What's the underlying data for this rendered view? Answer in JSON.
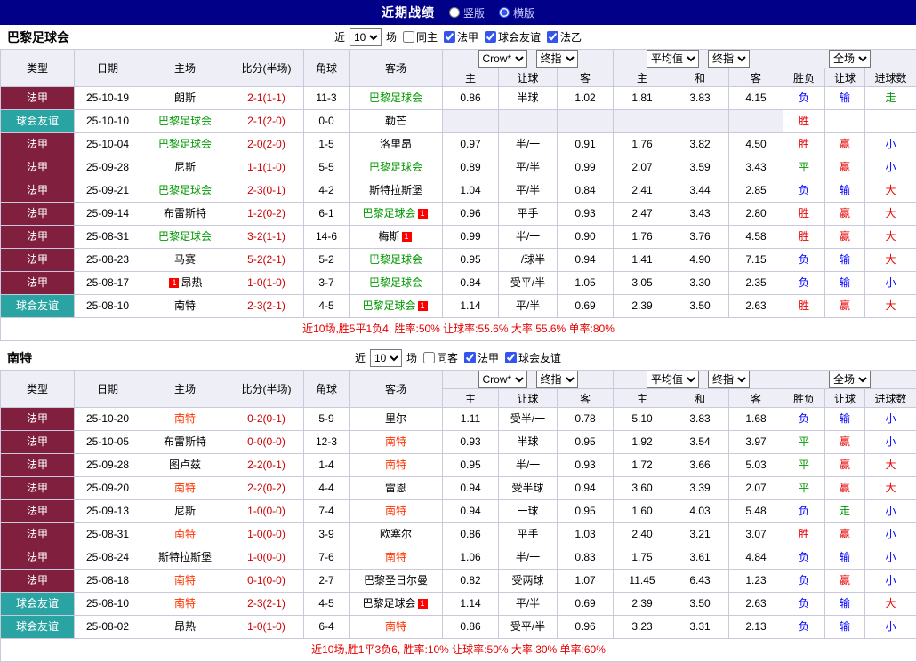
{
  "topbar": {
    "title": "近期战绩",
    "radios": [
      {
        "label": "竖版",
        "selected": false
      },
      {
        "label": "横版",
        "selected": true
      }
    ]
  },
  "filter": {
    "near": "近",
    "count": "10",
    "matches": "场"
  },
  "selects": {
    "crown": "Crow*",
    "final_index": "终指",
    "average": "平均值",
    "full_match": "全场"
  },
  "header": {
    "main": [
      "类型",
      "日期",
      "主场",
      "比分(半场)",
      "角球",
      "客场"
    ],
    "odds": [
      "主",
      "让球",
      "客"
    ],
    "avg": [
      "主",
      "和",
      "客"
    ],
    "result": [
      "胜负",
      "让球",
      "进球数"
    ]
  },
  "colors": {
    "topbar_bg": "#000088",
    "topbar_title": "#ffffff",
    "topbar_link": "#ccccff",
    "header_bg": "#eeeef6",
    "border_color": "#c9c9db",
    "league_bg": "#801f3e",
    "friendly_bg": "#2aa3a3",
    "team_green": "#009900",
    "team_red": "#ff3300",
    "score_color": "#cc0000",
    "win_color": "#e60000",
    "draw_color": "#009900",
    "loss_color": "#0000ff",
    "summary_color": "#e60000",
    "badge_bg": "#ff0000"
  },
  "sections": [
    {
      "team": "巴黎足球会",
      "filters": [
        {
          "label": "同主",
          "checked": false
        },
        {
          "label": "法甲",
          "checked": true
        },
        {
          "label": "球会友谊",
          "checked": true
        },
        {
          "label": "法乙",
          "checked": true
        }
      ],
      "rows": [
        {
          "type": "法甲",
          "type_style": "league",
          "date": "25-10-19",
          "home": "朗斯",
          "home_style": "black",
          "home_badge": "",
          "score": "2-1(1-1)",
          "corner": "11-3",
          "away": "巴黎足球会",
          "away_style": "green",
          "away_badge": "",
          "odds": [
            "0.86",
            "半球",
            "1.02",
            "1.81",
            "3.83",
            "4.15"
          ],
          "results": [
            {
              "t": "负",
              "c": "b"
            },
            {
              "t": "输",
              "c": "b"
            },
            {
              "t": "走",
              "c": "g"
            }
          ]
        },
        {
          "type": "球会友谊",
          "type_style": "friendly",
          "date": "25-10-10",
          "home": "巴黎足球会",
          "home_style": "green",
          "home_badge": "",
          "score": "2-1(2-0)",
          "corner": "0-0",
          "away": "勒芒",
          "away_style": "black",
          "away_badge": "",
          "odds": [
            "",
            "",
            "",
            "",
            "",
            ""
          ],
          "results": [
            {
              "t": "胜",
              "c": "r"
            },
            {
              "t": "",
              "c": ""
            },
            {
              "t": "",
              "c": ""
            }
          ]
        },
        {
          "type": "法甲",
          "type_style": "league",
          "date": "25-10-04",
          "home": "巴黎足球会",
          "home_style": "green",
          "home_badge": "",
          "score": "2-0(2-0)",
          "corner": "1-5",
          "away": "洛里昂",
          "away_style": "black",
          "away_badge": "",
          "odds": [
            "0.97",
            "半/一",
            "0.91",
            "1.76",
            "3.82",
            "4.50"
          ],
          "results": [
            {
              "t": "胜",
              "c": "r"
            },
            {
              "t": "赢",
              "c": "r"
            },
            {
              "t": "小",
              "c": "b"
            }
          ]
        },
        {
          "type": "法甲",
          "type_style": "league",
          "date": "25-09-28",
          "home": "尼斯",
          "home_style": "black",
          "home_badge": "",
          "score": "1-1(1-0)",
          "corner": "5-5",
          "away": "巴黎足球会",
          "away_style": "green",
          "away_badge": "",
          "odds": [
            "0.89",
            "平/半",
            "0.99",
            "2.07",
            "3.59",
            "3.43"
          ],
          "results": [
            {
              "t": "平",
              "c": "g"
            },
            {
              "t": "赢",
              "c": "r"
            },
            {
              "t": "小",
              "c": "b"
            }
          ]
        },
        {
          "type": "法甲",
          "type_style": "league",
          "date": "25-09-21",
          "home": "巴黎足球会",
          "home_style": "green",
          "home_badge": "",
          "score": "2-3(0-1)",
          "corner": "4-2",
          "away": "斯特拉斯堡",
          "away_style": "black",
          "away_badge": "",
          "odds": [
            "1.04",
            "平/半",
            "0.84",
            "2.41",
            "3.44",
            "2.85"
          ],
          "results": [
            {
              "t": "负",
              "c": "b"
            },
            {
              "t": "输",
              "c": "b"
            },
            {
              "t": "大",
              "c": "r"
            }
          ]
        },
        {
          "type": "法甲",
          "type_style": "league",
          "date": "25-09-14",
          "home": "布雷斯特",
          "home_style": "black",
          "home_badge": "",
          "score": "1-2(0-2)",
          "corner": "6-1",
          "away": "巴黎足球会",
          "away_style": "green",
          "away_badge": "1",
          "odds": [
            "0.96",
            "平手",
            "0.93",
            "2.47",
            "3.43",
            "2.80"
          ],
          "results": [
            {
              "t": "胜",
              "c": "r"
            },
            {
              "t": "赢",
              "c": "r"
            },
            {
              "t": "大",
              "c": "r"
            }
          ]
        },
        {
          "type": "法甲",
          "type_style": "league",
          "date": "25-08-31",
          "home": "巴黎足球会",
          "home_style": "green",
          "home_badge": "",
          "score": "3-2(1-1)",
          "corner": "14-6",
          "away": "梅斯",
          "away_style": "black",
          "away_badge": "1",
          "odds": [
            "0.99",
            "半/一",
            "0.90",
            "1.76",
            "3.76",
            "4.58"
          ],
          "results": [
            {
              "t": "胜",
              "c": "r"
            },
            {
              "t": "赢",
              "c": "r"
            },
            {
              "t": "大",
              "c": "r"
            }
          ]
        },
        {
          "type": "法甲",
          "type_style": "league",
          "date": "25-08-23",
          "home": "马赛",
          "home_style": "black",
          "home_badge": "",
          "score": "5-2(2-1)",
          "corner": "5-2",
          "away": "巴黎足球会",
          "away_style": "green",
          "away_badge": "",
          "odds": [
            "0.95",
            "一/球半",
            "0.94",
            "1.41",
            "4.90",
            "7.15"
          ],
          "results": [
            {
              "t": "负",
              "c": "b"
            },
            {
              "t": "输",
              "c": "b"
            },
            {
              "t": "大",
              "c": "r"
            }
          ]
        },
        {
          "type": "法甲",
          "type_style": "league",
          "date": "25-08-17",
          "home": "昂热",
          "home_style": "black",
          "home_badge": "1",
          "score": "1-0(1-0)",
          "corner": "3-7",
          "away": "巴黎足球会",
          "away_style": "green",
          "away_badge": "",
          "odds": [
            "0.84",
            "受平/半",
            "1.05",
            "3.05",
            "3.30",
            "2.35"
          ],
          "results": [
            {
              "t": "负",
              "c": "b"
            },
            {
              "t": "输",
              "c": "b"
            },
            {
              "t": "小",
              "c": "b"
            }
          ]
        },
        {
          "type": "球会友谊",
          "type_style": "friendly",
          "date": "25-08-10",
          "home": "南特",
          "home_style": "black",
          "home_badge": "",
          "score": "2-3(2-1)",
          "corner": "4-5",
          "away": "巴黎足球会",
          "away_style": "green",
          "away_badge": "1",
          "odds": [
            "1.14",
            "平/半",
            "0.69",
            "2.39",
            "3.50",
            "2.63"
          ],
          "results": [
            {
              "t": "胜",
              "c": "r"
            },
            {
              "t": "赢",
              "c": "r"
            },
            {
              "t": "大",
              "c": "r"
            }
          ]
        }
      ],
      "summary": "近10场,胜5平1负4, 胜率:50% 让球率:55.6% 大率:55.6% 单率:80%"
    },
    {
      "team": "南特",
      "filters": [
        {
          "label": "同客",
          "checked": false
        },
        {
          "label": "法甲",
          "checked": true
        },
        {
          "label": "球会友谊",
          "checked": true
        }
      ],
      "rows": [
        {
          "type": "法甲",
          "type_style": "league",
          "date": "25-10-20",
          "home": "南特",
          "home_style": "red",
          "home_badge": "",
          "score": "0-2(0-1)",
          "corner": "5-9",
          "away": "里尔",
          "away_style": "black",
          "away_badge": "",
          "odds": [
            "1.11",
            "受半/一",
            "0.78",
            "5.10",
            "3.83",
            "1.68"
          ],
          "results": [
            {
              "t": "负",
              "c": "b"
            },
            {
              "t": "输",
              "c": "b"
            },
            {
              "t": "小",
              "c": "b"
            }
          ]
        },
        {
          "type": "法甲",
          "type_style": "league",
          "date": "25-10-05",
          "home": "布雷斯特",
          "home_style": "black",
          "home_badge": "",
          "score": "0-0(0-0)",
          "corner": "12-3",
          "away": "南特",
          "away_style": "red",
          "away_badge": "",
          "odds": [
            "0.93",
            "半球",
            "0.95",
            "1.92",
            "3.54",
            "3.97"
          ],
          "results": [
            {
              "t": "平",
              "c": "g"
            },
            {
              "t": "赢",
              "c": "r"
            },
            {
              "t": "小",
              "c": "b"
            }
          ]
        },
        {
          "type": "法甲",
          "type_style": "league",
          "date": "25-09-28",
          "home": "图卢兹",
          "home_style": "black",
          "home_badge": "",
          "score": "2-2(0-1)",
          "corner": "1-4",
          "away": "南特",
          "away_style": "red",
          "away_badge": "",
          "odds": [
            "0.95",
            "半/一",
            "0.93",
            "1.72",
            "3.66",
            "5.03"
          ],
          "results": [
            {
              "t": "平",
              "c": "g"
            },
            {
              "t": "赢",
              "c": "r"
            },
            {
              "t": "大",
              "c": "r"
            }
          ]
        },
        {
          "type": "法甲",
          "type_style": "league",
          "date": "25-09-20",
          "home": "南特",
          "home_style": "red",
          "home_badge": "",
          "score": "2-2(0-2)",
          "corner": "4-4",
          "away": "雷恩",
          "away_style": "black",
          "away_badge": "",
          "odds": [
            "0.94",
            "受半球",
            "0.94",
            "3.60",
            "3.39",
            "2.07"
          ],
          "results": [
            {
              "t": "平",
              "c": "g"
            },
            {
              "t": "赢",
              "c": "r"
            },
            {
              "t": "大",
              "c": "r"
            }
          ]
        },
        {
          "type": "法甲",
          "type_style": "league",
          "date": "25-09-13",
          "home": "尼斯",
          "home_style": "black",
          "home_badge": "",
          "score": "1-0(0-0)",
          "corner": "7-4",
          "away": "南特",
          "away_style": "red",
          "away_badge": "",
          "odds": [
            "0.94",
            "一球",
            "0.95",
            "1.60",
            "4.03",
            "5.48"
          ],
          "results": [
            {
              "t": "负",
              "c": "b"
            },
            {
              "t": "走",
              "c": "g"
            },
            {
              "t": "小",
              "c": "b"
            }
          ]
        },
        {
          "type": "法甲",
          "type_style": "league",
          "date": "25-08-31",
          "home": "南特",
          "home_style": "red",
          "home_badge": "",
          "score": "1-0(0-0)",
          "corner": "3-9",
          "away": "欧塞尔",
          "away_style": "black",
          "away_badge": "",
          "odds": [
            "0.86",
            "平手",
            "1.03",
            "2.40",
            "3.21",
            "3.07"
          ],
          "results": [
            {
              "t": "胜",
              "c": "r"
            },
            {
              "t": "赢",
              "c": "r"
            },
            {
              "t": "小",
              "c": "b"
            }
          ]
        },
        {
          "type": "法甲",
          "type_style": "league",
          "date": "25-08-24",
          "home": "斯特拉斯堡",
          "home_style": "black",
          "home_badge": "",
          "score": "1-0(0-0)",
          "corner": "7-6",
          "away": "南特",
          "away_style": "red",
          "away_badge": "",
          "odds": [
            "1.06",
            "半/一",
            "0.83",
            "1.75",
            "3.61",
            "4.84"
          ],
          "results": [
            {
              "t": "负",
              "c": "b"
            },
            {
              "t": "输",
              "c": "b"
            },
            {
              "t": "小",
              "c": "b"
            }
          ]
        },
        {
          "type": "法甲",
          "type_style": "league",
          "date": "25-08-18",
          "home": "南特",
          "home_style": "red",
          "home_badge": "",
          "score": "0-1(0-0)",
          "corner": "2-7",
          "away": "巴黎圣日尔曼",
          "away_style": "black",
          "away_badge": "",
          "odds": [
            "0.82",
            "受两球",
            "1.07",
            "11.45",
            "6.43",
            "1.23"
          ],
          "results": [
            {
              "t": "负",
              "c": "b"
            },
            {
              "t": "赢",
              "c": "r"
            },
            {
              "t": "小",
              "c": "b"
            }
          ]
        },
        {
          "type": "球会友谊",
          "type_style": "friendly",
          "date": "25-08-10",
          "home": "南特",
          "home_style": "red",
          "home_badge": "",
          "score": "2-3(2-1)",
          "corner": "4-5",
          "away": "巴黎足球会",
          "away_style": "black",
          "away_badge": "1",
          "odds": [
            "1.14",
            "平/半",
            "0.69",
            "2.39",
            "3.50",
            "2.63"
          ],
          "results": [
            {
              "t": "负",
              "c": "b"
            },
            {
              "t": "输",
              "c": "b"
            },
            {
              "t": "大",
              "c": "r"
            }
          ]
        },
        {
          "type": "球会友谊",
          "type_style": "friendly",
          "date": "25-08-02",
          "home": "昂热",
          "home_style": "black",
          "home_badge": "",
          "score": "1-0(1-0)",
          "corner": "6-4",
          "away": "南特",
          "away_style": "red",
          "away_badge": "",
          "odds": [
            "0.86",
            "受平/半",
            "0.96",
            "3.23",
            "3.31",
            "2.13"
          ],
          "results": [
            {
              "t": "负",
              "c": "b"
            },
            {
              "t": "输",
              "c": "b"
            },
            {
              "t": "小",
              "c": "b"
            }
          ]
        }
      ],
      "summary": "近10场,胜1平3负6, 胜率:10% 让球率:50% 大率:30% 单率:60%"
    }
  ]
}
